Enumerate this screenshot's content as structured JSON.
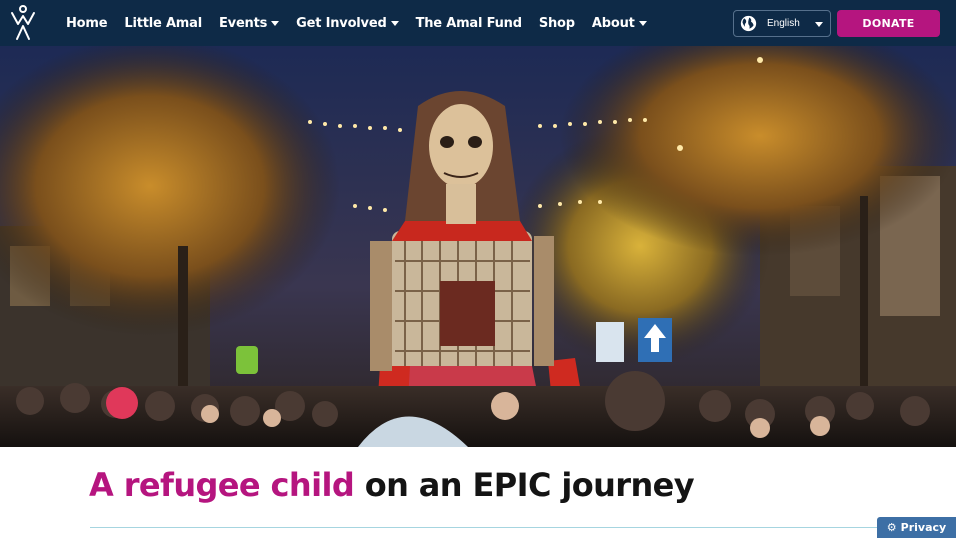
{
  "nav": {
    "logo_icon": "walk-with-amal-logo-icon",
    "items": [
      {
        "label": "Home",
        "has_dropdown": false
      },
      {
        "label": "Little Amal",
        "has_dropdown": false
      },
      {
        "label": "Events",
        "has_dropdown": true
      },
      {
        "label": "Get Involved",
        "has_dropdown": true
      },
      {
        "label": "The Amal Fund",
        "has_dropdown": false
      },
      {
        "label": "Shop",
        "has_dropdown": false
      },
      {
        "label": "About",
        "has_dropdown": true
      }
    ],
    "language": {
      "selected": "English",
      "icon": "globe-icon"
    },
    "donate_label": "DONATE",
    "background_color": "#0e2a47",
    "accent_color": "#b5157f"
  },
  "hero": {
    "image_icon": "little-amal-puppet-photo"
  },
  "headline": {
    "accent_text": "A refugee child",
    "rest_text": " on an EPIC journey"
  },
  "privacy": {
    "label": "Privacy",
    "icon": "gear-icon"
  }
}
